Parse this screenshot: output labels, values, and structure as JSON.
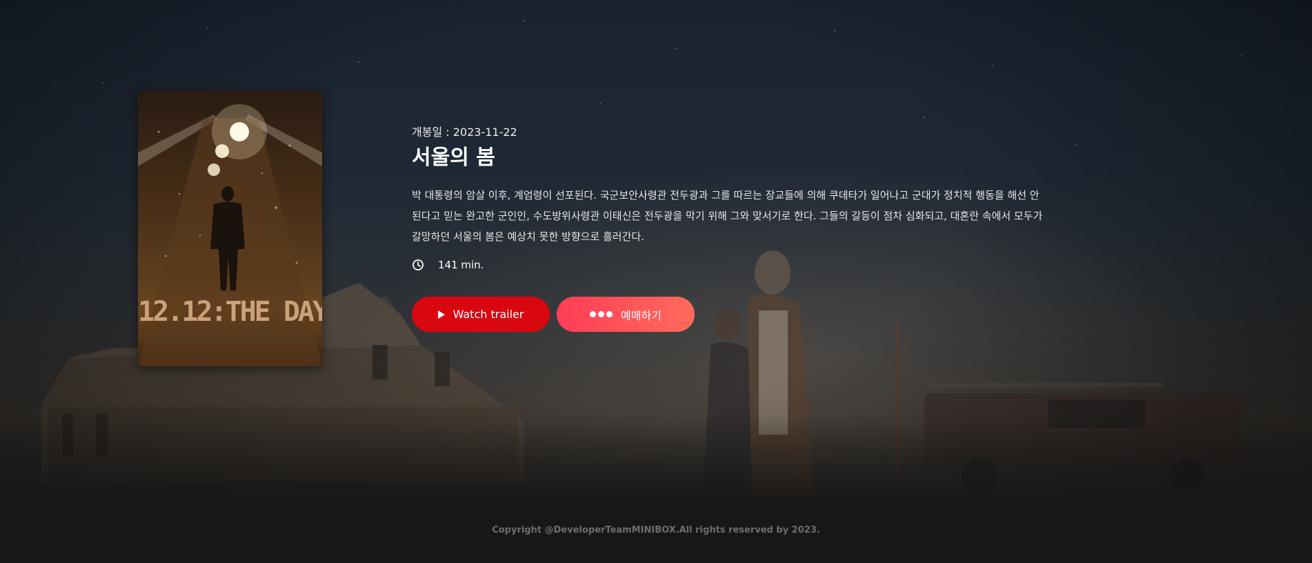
{
  "movie": {
    "release_label": "개봉일 : 2023-11-22",
    "title": "서울의 봄",
    "overview": "박 대통령의 암살 이후, 계엄령이 선포된다. 국군보안사령관 전두광과 그를 따르는 장교들에 의해 쿠데타가 일어나고 군대가 정치적 행동을 해선 안된다고 믿는 완고한 군인인, 수도방위사령관 이태신은 전두광을 막기 위해 그와 맞서기로 한다. 그들의 갈등이 점차 심화되고, 대혼란 속에서 모두가 갈망하던 서울의 봄은 예상치 못한 방향으로 흘러간다.",
    "runtime": "141 min.",
    "poster_title": "12.12:THE DAY"
  },
  "buttons": {
    "trailer_label": "Watch trailer",
    "book_label": "예매하기"
  },
  "icons": {
    "runtime": "clock-icon",
    "trailer": "play-icon",
    "book": "dots-icon"
  },
  "colors": {
    "trailer_button": "#d80710",
    "book_button_start": "#ff3c58",
    "book_button_end": "#ff6b5a",
    "footer_bg": "#171717",
    "footer_text": "#6e6e6e"
  },
  "footer": {
    "copyright": "Copyright @DeveloperTeamMINIBOX.All rights reserved by 2023."
  }
}
